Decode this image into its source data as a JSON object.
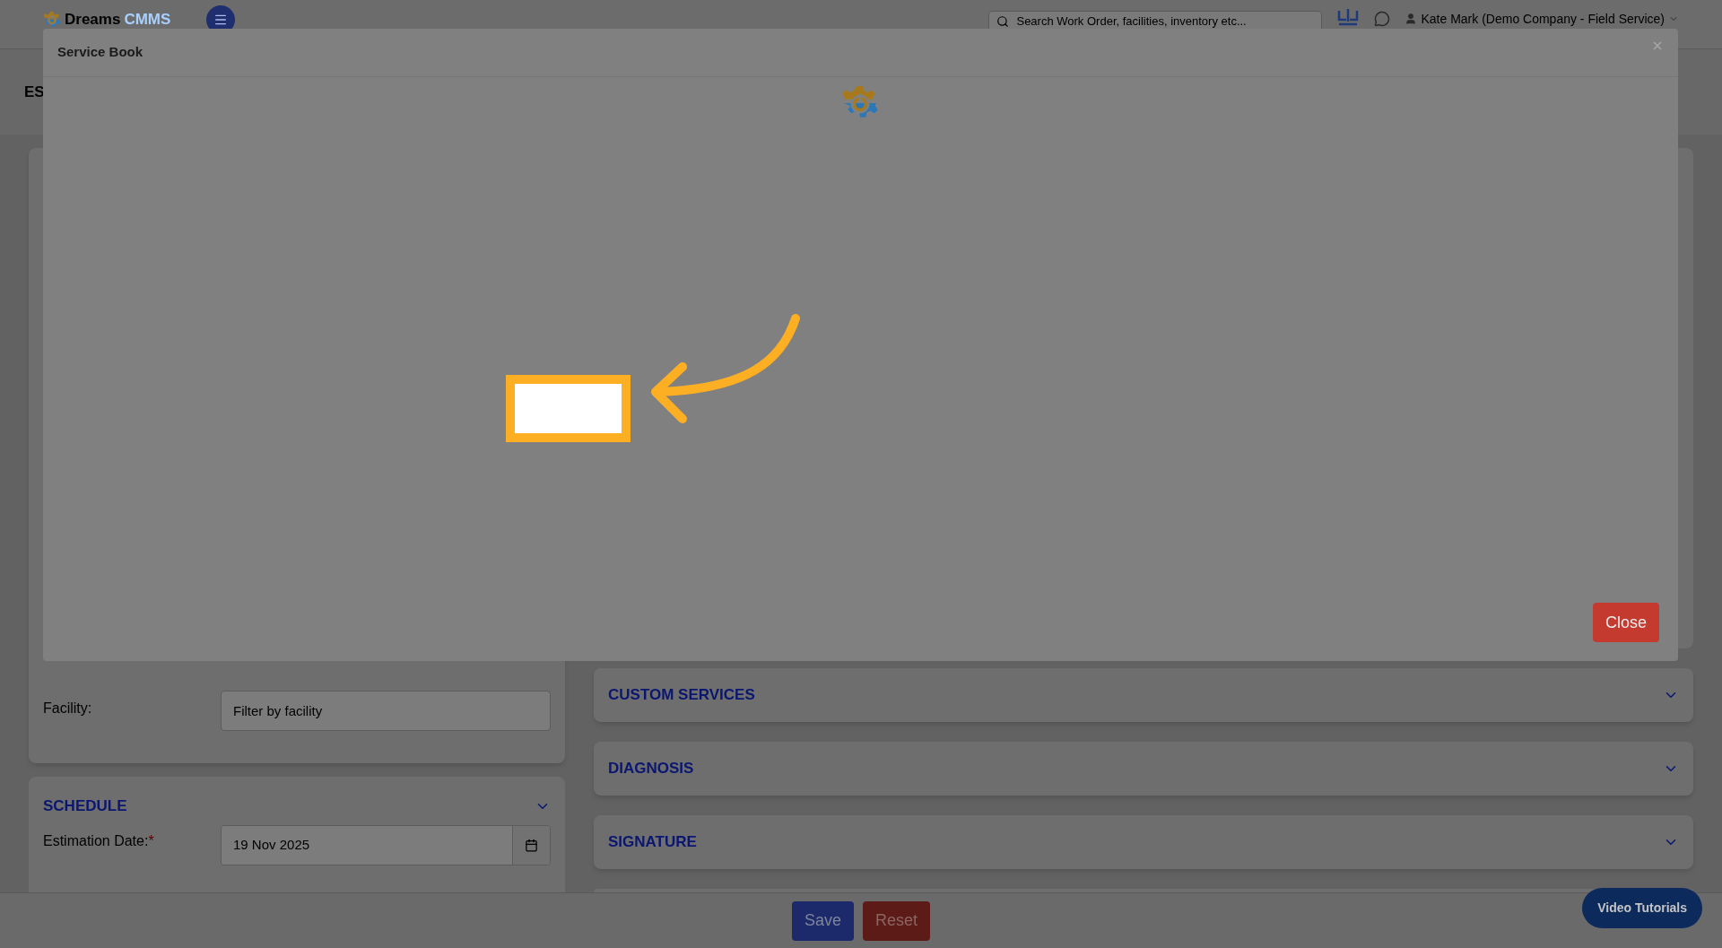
{
  "top_bar": {
    "logo": {
      "name": "Dreams",
      "accent": "CMMS"
    },
    "search": {
      "placeholder": "Search Work Order, facilities, inventory etc..."
    },
    "user": "Kate Mark (Demo Company - Field Service)"
  },
  "page": {
    "heading": "ES"
  },
  "left_column": {
    "facility": {
      "label": "Facility:",
      "placeholder": "Filter by facility"
    },
    "schedule": {
      "title": "SCHEDULE",
      "expanded": true,
      "fields": [
        {
          "label": "Estimation Date:",
          "required": true,
          "required_mark": "*",
          "value": "19 Nov 2025"
        }
      ]
    }
  },
  "right_column": {
    "sections": [
      {
        "title": "CUSTOM SERVICES",
        "expanded": false
      },
      {
        "title": "DIAGNOSIS",
        "expanded": false
      },
      {
        "title": "SIGNATURE",
        "expanded": false
      }
    ]
  },
  "footer": {
    "buttons": [
      {
        "label": "Save",
        "kind": "primary"
      },
      {
        "label": "Reset",
        "kind": "danger"
      }
    ]
  },
  "video_tutorials": "Video Tutorials",
  "modal": {
    "title": "Service Book",
    "close_button": "Close"
  }
}
